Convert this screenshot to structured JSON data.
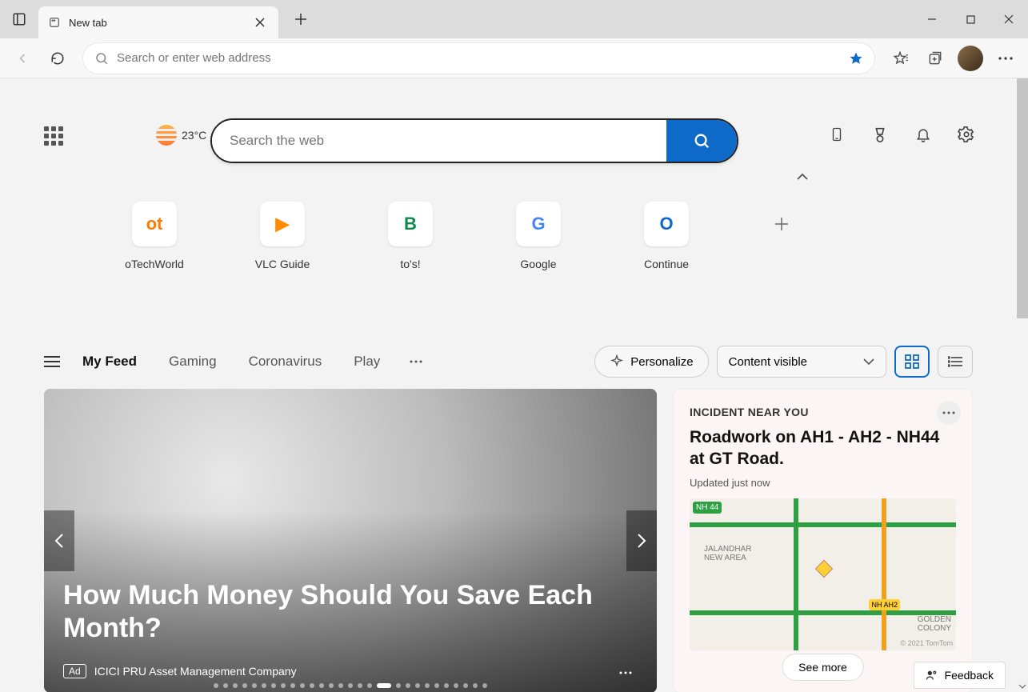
{
  "tab": {
    "title": "New tab"
  },
  "omnibox": {
    "placeholder": "Search or enter web address"
  },
  "weather": {
    "temp": "23°C"
  },
  "search": {
    "placeholder": "Search the web"
  },
  "tiles": [
    {
      "label": "oTechWorld",
      "icon_text": "ot",
      "icon_color": "#ff7b00"
    },
    {
      "label": "VLC Guide",
      "icon_text": "▶",
      "icon_color": "#ff8c00"
    },
    {
      "label": "to's!",
      "icon_text": "B",
      "icon_color": "#0f8a4a"
    },
    {
      "label": "Google",
      "icon_text": "G",
      "icon_color": "#4285f4"
    },
    {
      "label": "Continue",
      "icon_text": "O",
      "icon_color": "#0e6ac8"
    }
  ],
  "feed_tabs": [
    "My Feed",
    "Gaming",
    "Coronavirus",
    "Play"
  ],
  "personalize_label": "Personalize",
  "content_select_label": "Content visible",
  "hero": {
    "title": "How Much Money Should You Save Each Month?",
    "ad_badge": "Ad",
    "source": "ICICI PRU Asset Management Company"
  },
  "incident": {
    "label": "INCIDENT NEAR YOU",
    "title": "Roadwork on AH1 - AH2 - NH44 at GT Road.",
    "updated": "Updated just now",
    "seemore": "See more",
    "map_places": [
      "NH 44",
      "JALANDHAR NEW AREA",
      "NH AH2",
      "GOLDEN COLONY"
    ],
    "map_attrib": "© 2021 TomTom"
  },
  "feedback_label": "Feedback"
}
